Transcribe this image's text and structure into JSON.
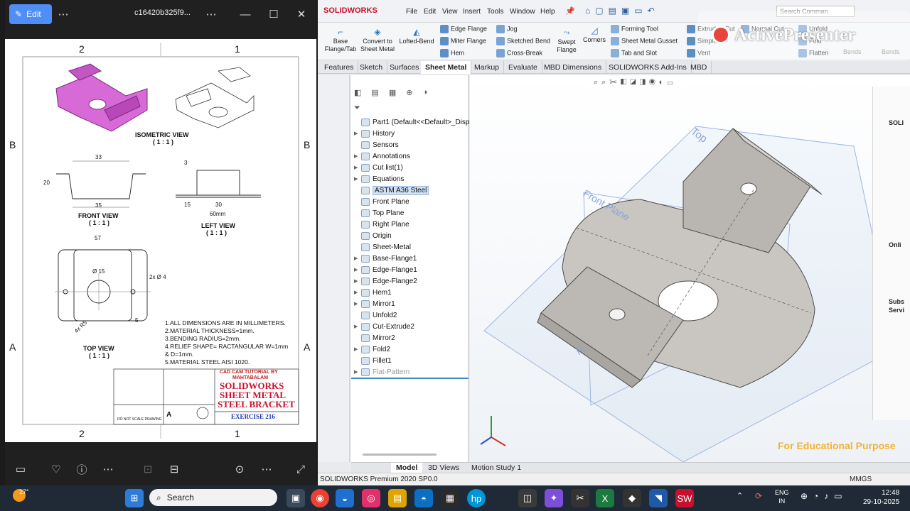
{
  "viewer": {
    "edit_label": "Edit",
    "file_name": "c16420b325f9...",
    "drawing": {
      "col_left": "2",
      "col_right": "1",
      "row_top": "B",
      "row_bottom": "A",
      "iso_title": "ISOMETRIC VIEW",
      "iso_scale": "( 1 : 1 )",
      "front_title": "FRONT VIEW",
      "front_scale": "( 1 : 1 )",
      "left_title": "LEFT VIEW",
      "left_scale": "( 1 : 1 )",
      "top_title": "TOP VIEW",
      "top_scale": "( 1 : 1 )",
      "dim_33": "33",
      "dim_20": "20",
      "dim_35": "35",
      "dim_3": "3",
      "dim_15": "15",
      "dim_30": "30",
      "dim_60": "60mm",
      "dim_57": "57",
      "dim_hole": "Ø 15",
      "dim_2x": "2x Ø 4",
      "dim_r5": "4x R5",
      "dim_5": "5",
      "notes": [
        "1.ALL DIMENSIONS ARE IN MILLIMETERS.",
        "2.MATERIAL THICKNESS=1mm.",
        "3.BENDING RADIUS=2mm.",
        "4.RELIEF SHAPE= RACTANGULAR W=1mm",
        "& D=1mm.",
        "5.MATERIAL STEEL AISI 1020."
      ],
      "tb_cadcam": "CAD CAM TUTORIAL BY",
      "tb_author": "MAHTABALAM",
      "tb_title1": "SOLIDWORKS",
      "tb_title2": "SHEET METAL",
      "tb_title3": "STEEL BRACKET",
      "tb_exercise": "EXERCISE 216",
      "tb_size": "A",
      "tb_noscale": "DO NOT SCALE DRAWING"
    }
  },
  "sw": {
    "brand": "SOLIDWORKS",
    "menus": [
      "File",
      "Edit",
      "View",
      "Insert",
      "Tools",
      "Window",
      "Help"
    ],
    "search_placeholder": "Search Comman",
    "ribbon": {
      "base_flange": "Base Flange/Tab",
      "convert": "Convert to Sheet Metal",
      "lofted": "Lofted-Bend",
      "edge_flange": "Edge Flange",
      "miter_flange": "Miter Flange",
      "hem": "Hem",
      "jog": "Jog",
      "sketched_bend": "Sketched Bend",
      "cross_break": "Cross-Break",
      "swept_flange": "Swept Flange",
      "corners": "Corners",
      "forming_tool": "Forming Tool",
      "gusset": "Sheet Metal Gusset",
      "tab_slot": "Tab and Slot",
      "extruded_cut": "Extruded Cut",
      "simple_hole": "Simple",
      "vent": "Vent",
      "normal_cut": "Normal Cut",
      "unfold": "Unfold",
      "fold": "Fold",
      "flatten": "Flatten",
      "no_bends": "Bends",
      "rip": "Bends"
    },
    "tabs": [
      "Features",
      "Sketch",
      "Surfaces",
      "Sheet Metal",
      "Markup",
      "Evaluate",
      "MBD Dimensions",
      "SOLIDWORKS Add-Ins",
      "MBD"
    ],
    "active_tab": "Sheet Metal",
    "tree": [
      {
        "label": "Part1  (Default<<Default>_Displa",
        "arrow": ""
      },
      {
        "label": "History",
        "arrow": "▶"
      },
      {
        "label": "Sensors",
        "arrow": ""
      },
      {
        "label": "Annotations",
        "arrow": "▶"
      },
      {
        "label": "Cut list(1)",
        "arrow": "▶"
      },
      {
        "label": "Equations",
        "arrow": "▶"
      },
      {
        "label": "ASTM A36 Steel",
        "arrow": ""
      },
      {
        "label": "Front Plane",
        "arrow": ""
      },
      {
        "label": "Top Plane",
        "arrow": ""
      },
      {
        "label": "Right Plane",
        "arrow": ""
      },
      {
        "label": "Origin",
        "arrow": ""
      },
      {
        "label": "Sheet-Metal",
        "arrow": ""
      },
      {
        "label": "Base-Flange1",
        "arrow": "▶"
      },
      {
        "label": "Edge-Flange1",
        "arrow": "▶"
      },
      {
        "label": "Edge-Flange2",
        "arrow": "▶"
      },
      {
        "label": "Hem1",
        "arrow": "▶"
      },
      {
        "label": "Mirror1",
        "arrow": "▶"
      },
      {
        "label": "Unfold2",
        "arrow": ""
      },
      {
        "label": "Cut-Extrude2",
        "arrow": "▶"
      },
      {
        "label": "Mirror2",
        "arrow": ""
      },
      {
        "label": "Fold2",
        "arrow": "▶"
      },
      {
        "label": "Fillet1",
        "arrow": ""
      },
      {
        "label": "Flat-Pattern",
        "arrow": "▶"
      }
    ],
    "planes": {
      "top": "Top",
      "front": "Front Plane",
      "right": "Ri"
    },
    "bottom_tabs": [
      "Model",
      "3D Views",
      "Motion Study 1"
    ],
    "status_text": "SOLIDWORKS Premium 2020 SP0.0",
    "units": "MMGS",
    "watermark": "ActivePresenter",
    "edu": "For Educational Purpose",
    "taskpane": {
      "solid": "SOLI",
      "onli": "Onli",
      "subs": "Subs",
      "servi": "Servi"
    }
  },
  "taskbar": {
    "temp": "27°",
    "search": "Search",
    "lang1": "ENG",
    "lang2": "IN",
    "time": "12:48",
    "date": "29-10-2025"
  },
  "colors": {
    "accent": "#4f8ef7",
    "sw_red": "#c8102e",
    "part_grey": "#c9c5c0",
    "iso_pink": "#d86ad8",
    "edu": "#f3b234"
  }
}
